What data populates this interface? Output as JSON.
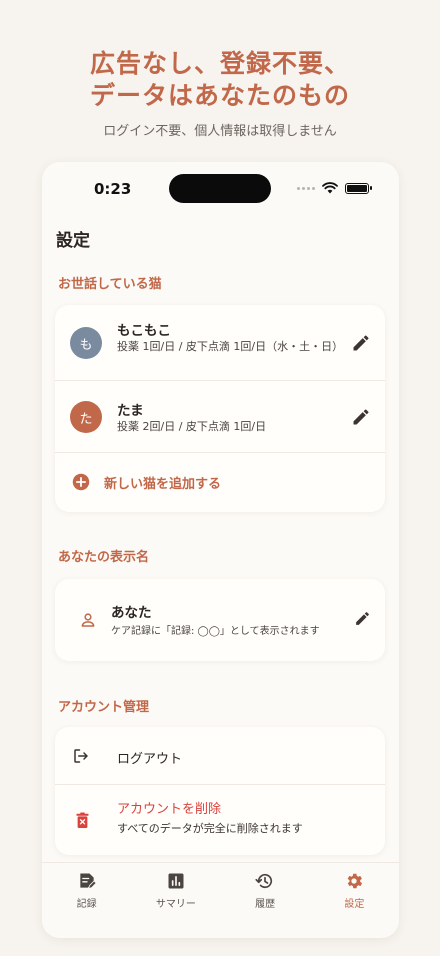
{
  "promo": {
    "headline_line1": "広告なし、登録不要、",
    "headline_line2": "データはあなたのもの",
    "subline": "ログイン不要、個人情報は取得しません"
  },
  "status_bar": {
    "time": "0:23"
  },
  "page": {
    "title": "設定"
  },
  "cats_section": {
    "title": "お世話している猫",
    "cats": [
      {
        "initial": "も",
        "name": "もこもこ",
        "desc": "投薬 1回/日 / 皮下点滴 1回/日（水・土・日）",
        "avatar_color": "#7a8ba0"
      },
      {
        "initial": "た",
        "name": "たま",
        "desc": "投薬 2回/日 / 皮下点滴 1回/日",
        "avatar_color": "#c2684a"
      }
    ],
    "add_label": "新しい猫を追加する"
  },
  "display_name_section": {
    "title": "あなたの表示名",
    "name": "あなた",
    "desc": "ケア記録に「記録: ◯◯」として表示されます"
  },
  "account_section": {
    "title": "アカウント管理",
    "logout_label": "ログアウト",
    "delete_label": "アカウントを削除",
    "delete_desc": "すべてのデータが完全に削除されます"
  },
  "nav": {
    "items": [
      {
        "label": "記録",
        "icon": "edit-note-icon"
      },
      {
        "label": "サマリー",
        "icon": "bar-chart-icon"
      },
      {
        "label": "履歴",
        "icon": "history-icon"
      },
      {
        "label": "設定",
        "icon": "gear-icon"
      }
    ],
    "active_index": 3
  },
  "colors": {
    "accent": "#c2684a",
    "danger": "#d9423d",
    "background": "#f7f3ee"
  }
}
